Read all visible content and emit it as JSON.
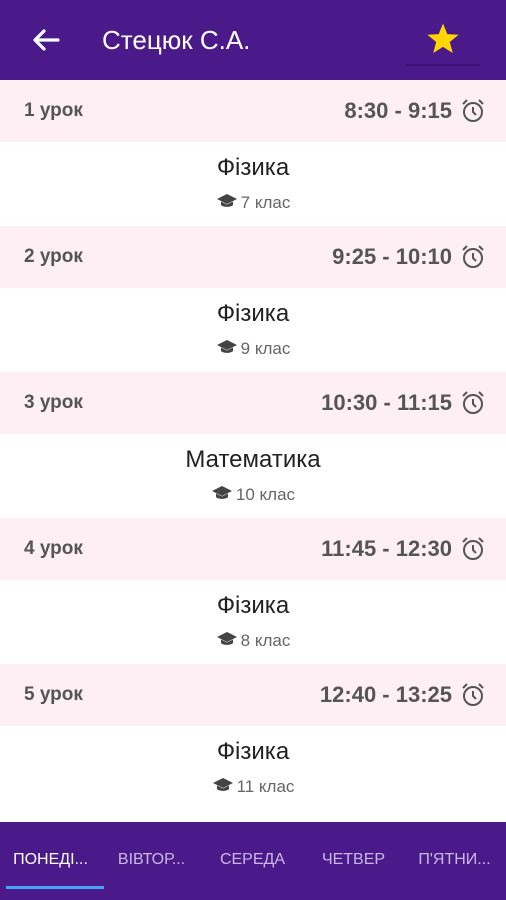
{
  "appbar": {
    "title": "Стецюк С.А.",
    "back_icon": "arrow-left-icon",
    "favorite_icon": "star-icon",
    "favorite_color": "#FFD600"
  },
  "lessons": [
    {
      "number": "1 урок",
      "time": "8:30 - 9:15",
      "subject": "Фізика",
      "class": "7 клас"
    },
    {
      "number": "2 урок",
      "time": "9:25 - 10:10",
      "subject": "Фізика",
      "class": "9 клас"
    },
    {
      "number": "3 урок",
      "time": "10:30 - 11:15",
      "subject": "Математика",
      "class": "10 клас"
    },
    {
      "number": "4 урок",
      "time": "11:45 - 12:30",
      "subject": "Фізика",
      "class": "8 клас"
    },
    {
      "number": "5 урок",
      "time": "12:40 - 13:25",
      "subject": "Фізика",
      "class": "11 клас"
    }
  ],
  "tabs": [
    {
      "label": "ПОНЕДІ...",
      "active": true
    },
    {
      "label": "ВІВТОР...",
      "active": false
    },
    {
      "label": "СЕРЕДА",
      "active": false
    },
    {
      "label": "ЧЕТВЕР",
      "active": false
    },
    {
      "label": "П'ЯТНИ...",
      "active": false
    }
  ],
  "colors": {
    "primary": "#4b1a8a",
    "lesson_header_bg": "#fdeff3",
    "tab_indicator": "#42a5f5"
  }
}
